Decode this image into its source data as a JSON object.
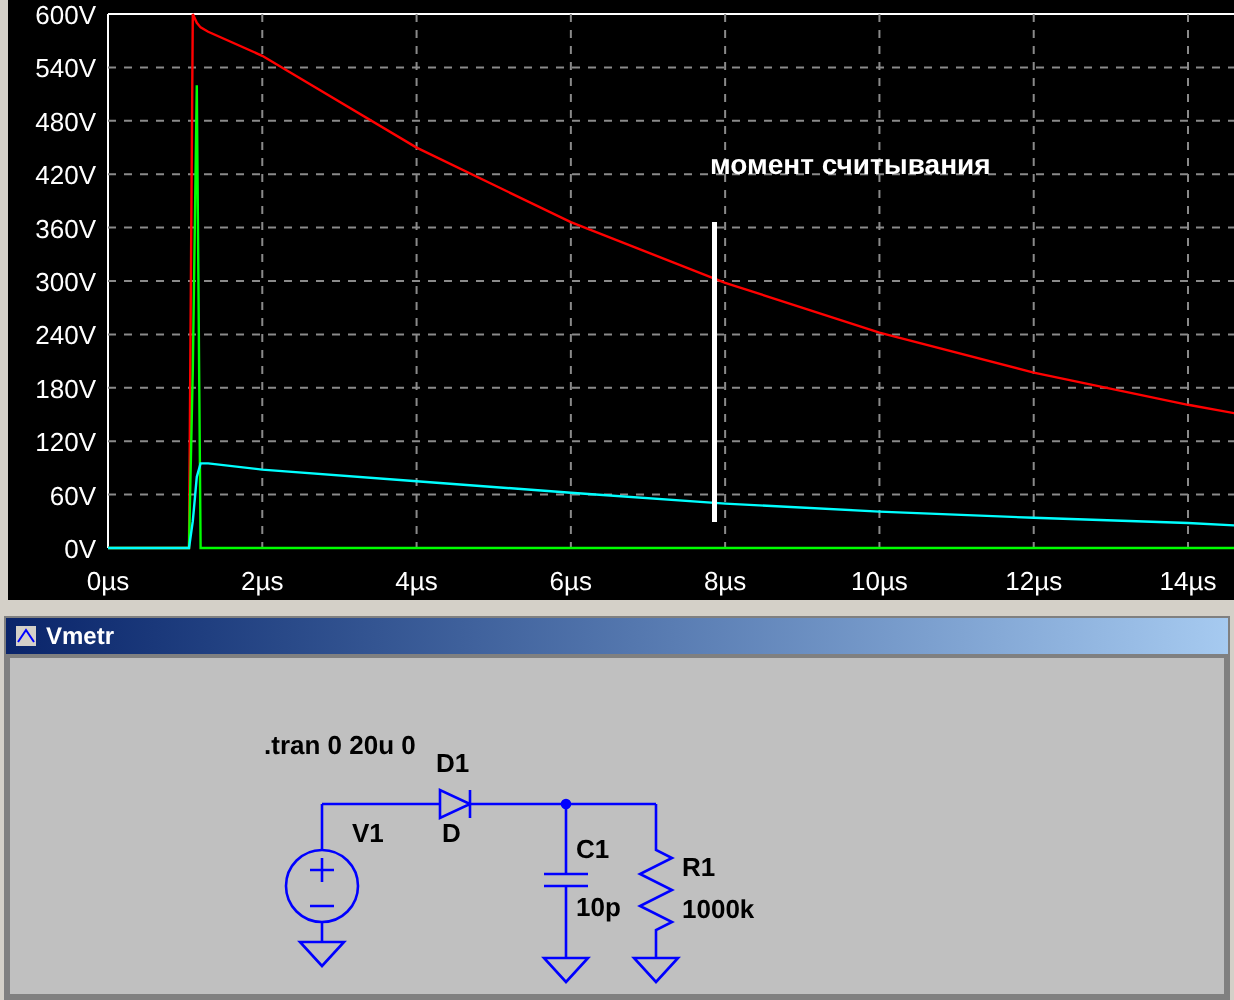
{
  "plot": {
    "chart_data": {
      "type": "line",
      "x": [
        0,
        1,
        1.05,
        1.1,
        1.15,
        1.2,
        1.3,
        2,
        4,
        6,
        8,
        10,
        12,
        14,
        14.7
      ],
      "series": [
        {
          "color": "#ff0000",
          "values": [
            0,
            0,
            0,
            600,
            590,
            585,
            580,
            553,
            450,
            366,
            298,
            242,
            197,
            161,
            150
          ]
        },
        {
          "color": "#00ff00",
          "values": [
            0,
            0,
            0,
            200,
            520,
            0,
            0,
            0,
            0,
            0,
            0,
            0,
            0,
            0,
            0
          ]
        },
        {
          "color": "#00ffff",
          "values": [
            0,
            0,
            0,
            30,
            80,
            95,
            95,
            88,
            75,
            62,
            50,
            41,
            34,
            28,
            25
          ]
        }
      ],
      "xlim": [
        0,
        14.7
      ],
      "ylim": [
        0,
        600
      ],
      "grid": true,
      "xticks": [
        {
          "value": 0,
          "label": "0µs"
        },
        {
          "value": 2,
          "label": "2µs"
        },
        {
          "value": 4,
          "label": "4µs"
        },
        {
          "value": 6,
          "label": "6µs"
        },
        {
          "value": 8,
          "label": "8µs"
        },
        {
          "value": 10,
          "label": "10µs"
        },
        {
          "value": 12,
          "label": "12µs"
        },
        {
          "value": 14,
          "label": "14µs"
        }
      ],
      "yticks": [
        {
          "value": 0,
          "label": "0V"
        },
        {
          "value": 60,
          "label": "60V"
        },
        {
          "value": 120,
          "label": "120V"
        },
        {
          "value": 180,
          "label": "180V"
        },
        {
          "value": 240,
          "label": "240V"
        },
        {
          "value": 300,
          "label": "300V"
        },
        {
          "value": 360,
          "label": "360V"
        },
        {
          "value": 420,
          "label": "420V"
        },
        {
          "value": 480,
          "label": "480V"
        },
        {
          "value": 540,
          "label": "540V"
        },
        {
          "value": 600,
          "label": "600V"
        }
      ],
      "annotations": [
        "момент считывания"
      ]
    }
  },
  "schematic_window": {
    "title": "Vmetr",
    "labels": [
      ".tran 0 20u 0",
      "D1",
      "D",
      "V1",
      "C1",
      "10p",
      "R1",
      "1000k"
    ]
  }
}
